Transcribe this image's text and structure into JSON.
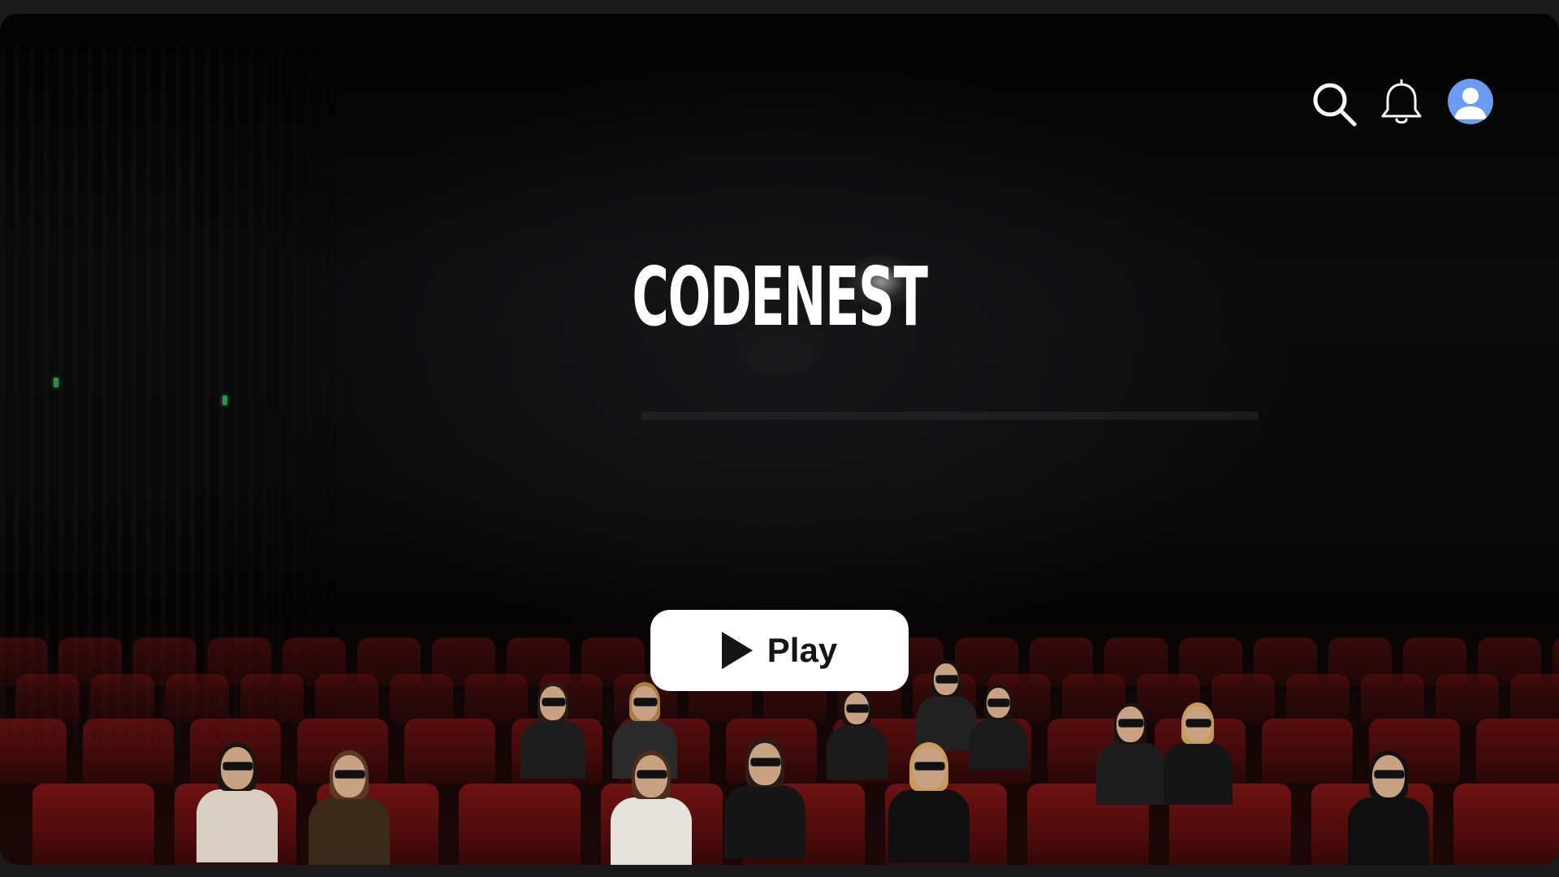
{
  "app": {
    "title": "CODENEST"
  },
  "header": {
    "icons": [
      "search-icon",
      "bell-icon",
      "user-avatar-icon"
    ]
  },
  "hero": {
    "play_label": "Play",
    "play_icon": "play-icon"
  },
  "colors": {
    "background": "#050505",
    "title": "#ffffff",
    "play_button_bg": "#ffffff",
    "play_button_text": "#151515",
    "avatar_bg": "#6a9df2",
    "seat_red": "#6e1212"
  }
}
